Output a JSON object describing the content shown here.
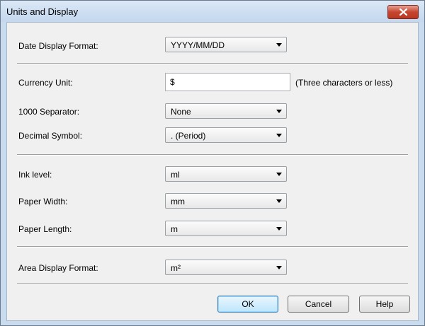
{
  "window": {
    "title": "Units and Display"
  },
  "fields": {
    "date_format": {
      "label": "Date Display Format:",
      "value": "YYYY/MM/DD"
    },
    "currency": {
      "label": "Currency Unit:",
      "value": "$",
      "note": "(Three characters or less)"
    },
    "thousand_sep": {
      "label": "1000 Separator:",
      "value": "None"
    },
    "decimal": {
      "label": "Decimal Symbol:",
      "value": ". (Period)"
    },
    "ink": {
      "label": "Ink level:",
      "value": "ml"
    },
    "paper_width": {
      "label": "Paper Width:",
      "value": "mm"
    },
    "paper_length": {
      "label": "Paper Length:",
      "value": "m"
    },
    "area": {
      "label": "Area Display Format:",
      "value": "m²"
    }
  },
  "buttons": {
    "ok": "OK",
    "cancel": "Cancel",
    "help": "Help"
  },
  "icons": {
    "close": "close-icon"
  },
  "colors": {
    "close_button": "#c7452f",
    "title_bar": "#c9dcef"
  }
}
